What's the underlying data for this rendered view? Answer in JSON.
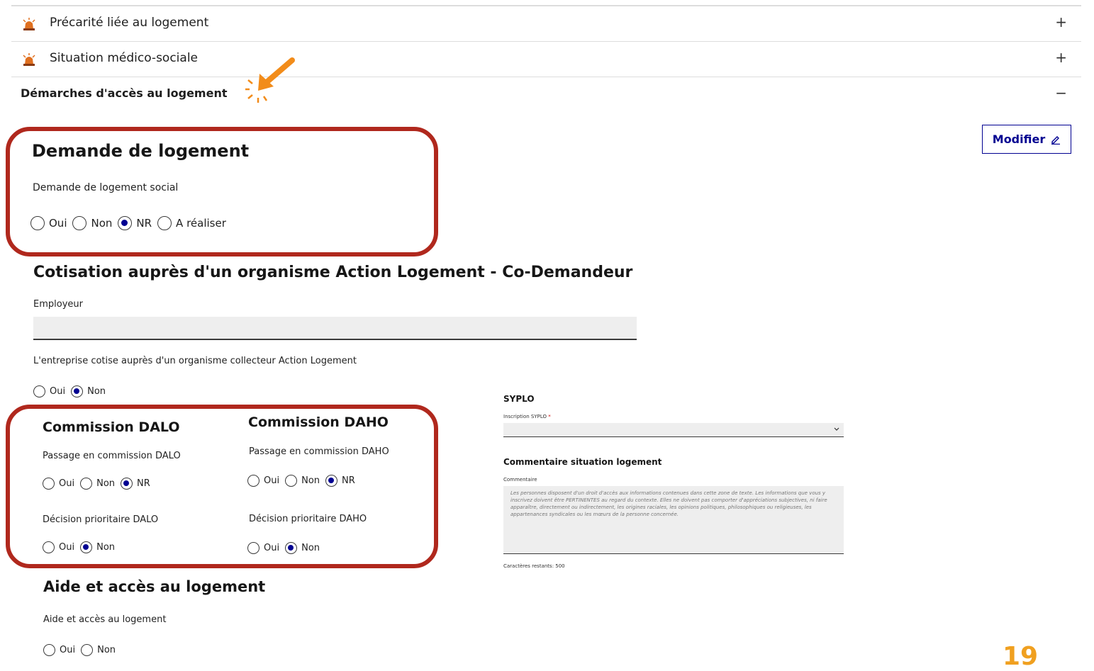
{
  "accordion": {
    "items": [
      {
        "label": "Précarité liée au logement",
        "sign": "+"
      },
      {
        "label": "Situation médico-sociale",
        "sign": "+"
      },
      {
        "label": "Démarches d'accès au logement",
        "sign": "−"
      }
    ]
  },
  "toolbar": {
    "modifier_label": "Modifier"
  },
  "sections": {
    "demande": {
      "title": "Demande de logement",
      "question": "Demande de logement social",
      "options": [
        "Oui",
        "Non",
        "NR",
        "A réaliser"
      ],
      "selected": "NR"
    },
    "cotisation": {
      "title": "Cotisation auprès d'un organisme Action Logement - Co-Demandeur",
      "employeur_label": "Employeur",
      "employeur_value": "",
      "question": "L'entreprise cotise auprès d'un organisme collecteur Action Logement",
      "options": [
        "Oui",
        "Non"
      ],
      "selected": "Non"
    },
    "dalo": {
      "title": "Commission DALO",
      "passage_label": "Passage en commission DALO",
      "passage_options": [
        "Oui",
        "Non",
        "NR"
      ],
      "passage_selected": "NR",
      "decision_label": "Décision prioritaire DALO",
      "decision_options": [
        "Oui",
        "Non"
      ],
      "decision_selected": "Non"
    },
    "daho": {
      "title": "Commission DAHO",
      "passage_label": "Passage en commission DAHO",
      "passage_options": [
        "Oui",
        "Non",
        "NR"
      ],
      "passage_selected": "NR",
      "decision_label": "Décision prioritaire DAHO",
      "decision_options": [
        "Oui",
        "Non"
      ],
      "decision_selected": "Non"
    },
    "aide": {
      "title": "Aide et accès au logement",
      "question": "Aide et accès au logement",
      "options": [
        "Oui",
        "Non"
      ],
      "selected": ""
    },
    "syplo": {
      "title": "SYPLO",
      "select_label": "Inscription SYPLO",
      "required_mark": "*",
      "select_value": ""
    },
    "commentaire": {
      "title": "Commentaire situation logement",
      "label": "Commentaire",
      "placeholder": "Les personnes disposent d'un droit d'accès aux informations contenues dans cette zone de texte. Les informations que vous y inscrivez doivent être PERTINENTES au regard du contexte. Elles ne doivent pas comporter d'appréciations subjectives, ni faire apparaître, directement ou indirectement, les origines raciales, les opinions politiques, philosophiques ou religieuses, les appartenances syndicales ou les mœurs de la personne concernée.",
      "remaining": "Caractères restants: 500"
    }
  },
  "page_number": "19",
  "colors": {
    "accent": "#000091",
    "highlight": "#b0281d",
    "arrow": "#f28c1a",
    "page_number": "#f0a020",
    "bell": "#e07020"
  }
}
